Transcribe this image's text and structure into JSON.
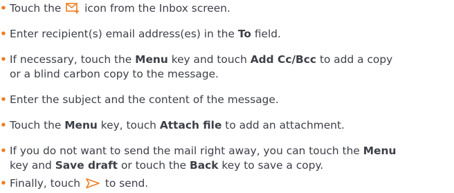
{
  "bullet": "•",
  "accent_color": "#f07c21",
  "text_color": "#3c3f47",
  "icons": {
    "compose": "compose-mail-icon",
    "send": "send-arrow-icon"
  },
  "steps": [
    {
      "pre": "Touch the",
      "icon": "compose-mail-icon",
      "post": "icon from the Inbox screen."
    },
    {
      "pre": "Enter recipient(s) email address(es) in the ",
      "kw1": "To",
      "post": " field."
    },
    {
      "pre": "If necessary, touch the ",
      "kw1": "Menu",
      "mid": " key and touch ",
      "kw2": "Add Cc/Bcc",
      "post": " to add a copy",
      "cont": "or a blind carbon copy to the message."
    },
    {
      "text": "Enter the subject and the content of the message."
    },
    {
      "pre": "Touch the ",
      "kw1": "Menu",
      "mid": " key, touch ",
      "kw2": "Attach file",
      "post": " to add an attachment."
    },
    {
      "pre": "If you do not want to send the mail right away, you can touch the ",
      "kw1": "Menu",
      "cont_pre": "key  and ",
      "kw2": "Save draft",
      "cont_mid": " or touch the ",
      "kw3": "Back",
      "cont_post": " key to save a copy."
    },
    {
      "pre": "Finally, touch",
      "icon": "send-arrow-icon",
      "post": "to send."
    }
  ]
}
